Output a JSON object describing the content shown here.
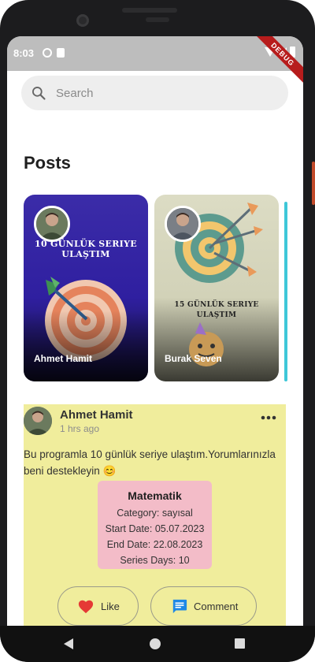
{
  "status_bar": {
    "time": "8:03",
    "debug_label": "DEBUG"
  },
  "search": {
    "placeholder": "Search"
  },
  "posts_heading": "Posts",
  "stories": [
    {
      "caption": "10 GÜNLÜK SERIYE ULAŞTIM",
      "name": "Ahmet Hamit"
    },
    {
      "caption": "15 GÜNLÜK SERIYE ULAŞTIM",
      "name": "Burak Seven"
    }
  ],
  "post": {
    "author": "Ahmet Hamit",
    "time": "1 hrs ago",
    "text": "Bu programla 10 günlük seriye ulaştım.Yorumlarınızla beni destekleyin 😊",
    "card": {
      "title": "Matematik",
      "category": "Category: sayısal",
      "start": "Start Date: 05.07.2023",
      "end": "End Date: 22.08.2023",
      "days": "Series Days: 10"
    },
    "like_label": "Like",
    "comment_label": "Comment"
  },
  "colors": {
    "post_background": "#f0ed9c",
    "info_card": "#f3bcc8",
    "like_heart": "#e53935",
    "comment_icon": "#1e88e5",
    "debug_ribbon": "#b71c1c"
  },
  "icons": [
    "search-icon",
    "more-icon",
    "heart-icon",
    "comment-icon",
    "wifi-icon",
    "signal-icon",
    "battery-icon"
  ]
}
